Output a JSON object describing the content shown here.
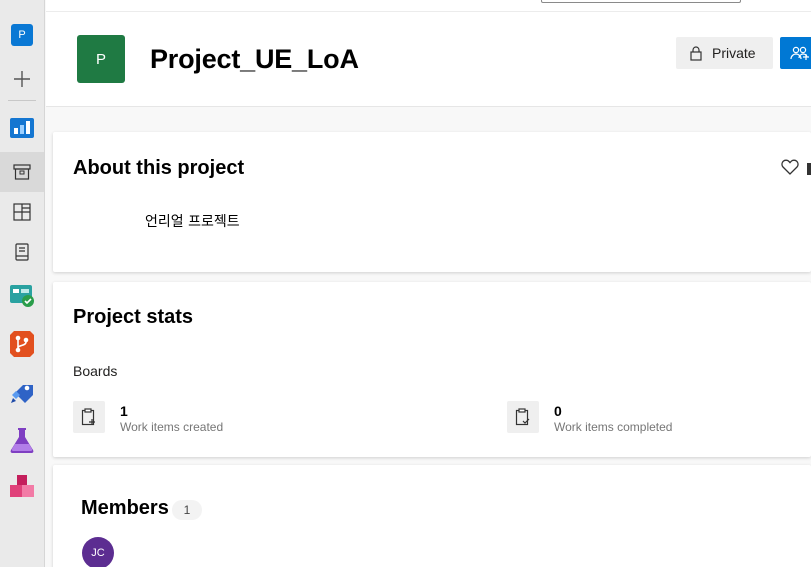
{
  "rail": {
    "project_initial": "P",
    "items": [
      {
        "name": "add",
        "icon": "plus-icon"
      },
      {
        "name": "overview",
        "icon": "overview-icon"
      },
      {
        "name": "summary",
        "icon": "summary-icon"
      },
      {
        "name": "dashboards",
        "icon": "dashboards-icon"
      },
      {
        "name": "wiki",
        "icon": "wiki-icon"
      },
      {
        "name": "boards",
        "icon": "boards-icon"
      },
      {
        "name": "repos",
        "icon": "repos-icon"
      },
      {
        "name": "pipelines",
        "icon": "pipelines-icon"
      },
      {
        "name": "test-plans",
        "icon": "test-plans-icon"
      },
      {
        "name": "artifacts",
        "icon": "artifacts-icon"
      }
    ]
  },
  "header": {
    "project_initial": "P",
    "project_name": "Project_UE_LoA",
    "private_label": "Private"
  },
  "about": {
    "title": "About this project",
    "description": "언리얼 프로젝트"
  },
  "stats": {
    "title": "Project stats",
    "section_label": "Boards",
    "items": [
      {
        "value": "1",
        "label": "Work items created"
      },
      {
        "value": "0",
        "label": "Work items completed"
      }
    ]
  },
  "members": {
    "title": "Members",
    "count": "1",
    "avatar_initials": "JC"
  },
  "colors": {
    "accent": "#0078d4",
    "project_avatar": "#1f7a43",
    "member_avatar": "#5c2d91"
  }
}
